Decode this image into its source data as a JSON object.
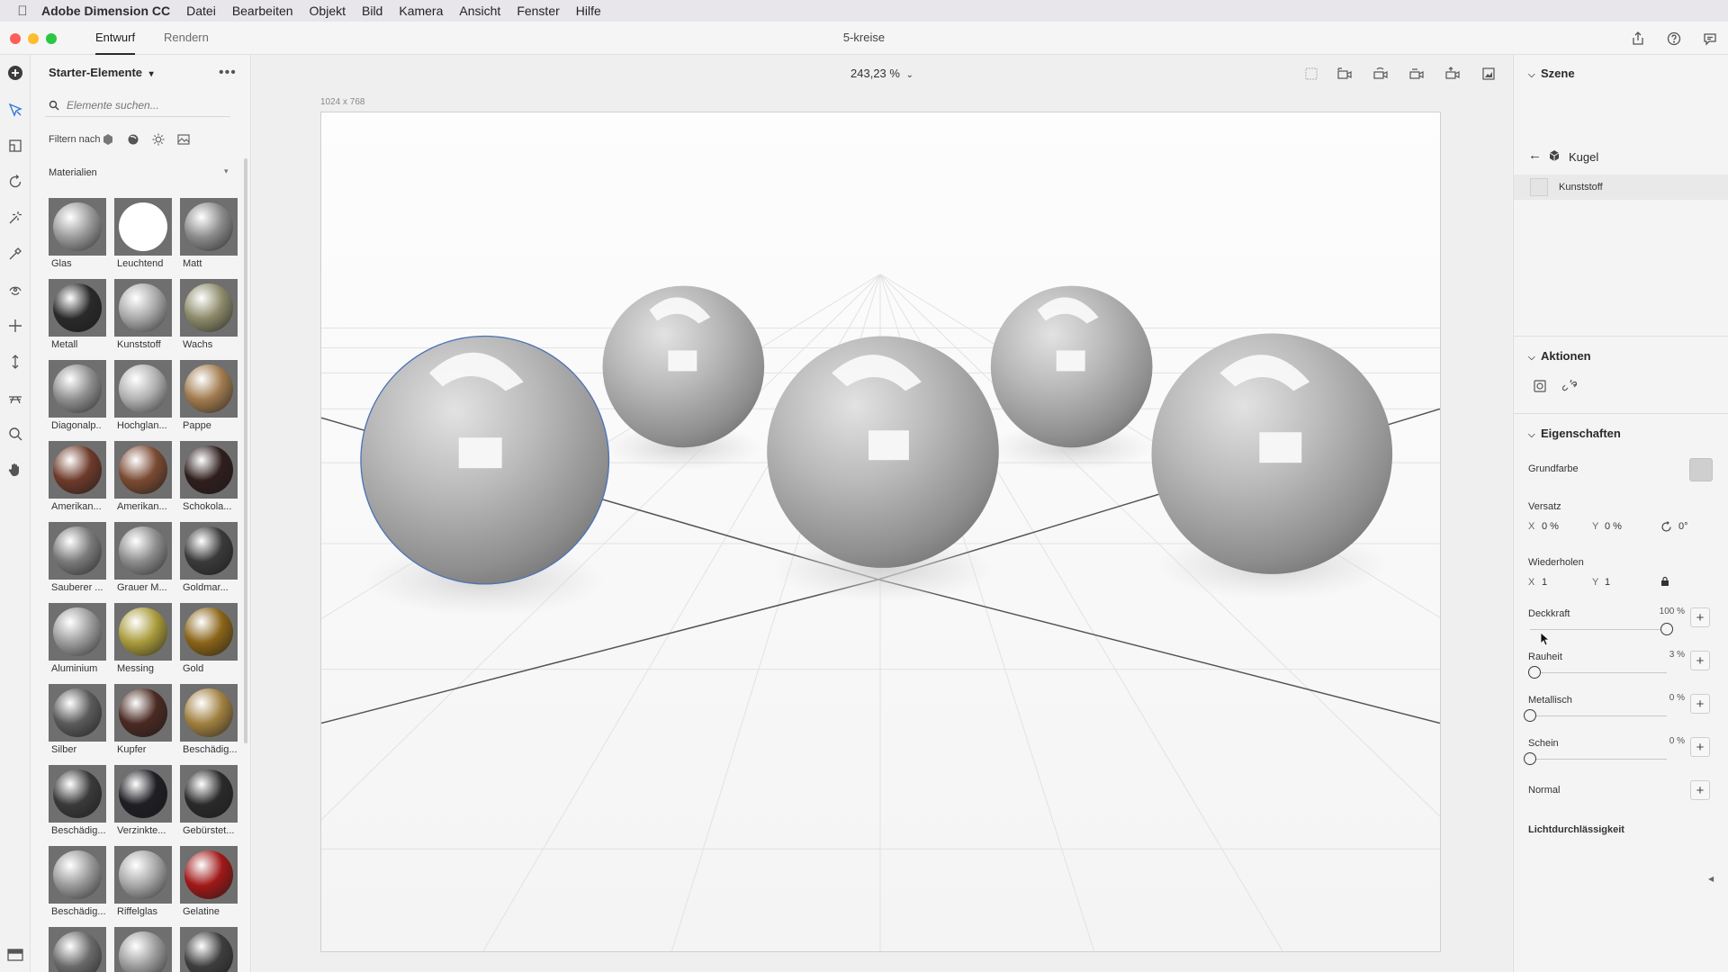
{
  "menubar": {
    "app_name": "Adobe Dimension CC",
    "items": [
      "Datei",
      "Bearbeiten",
      "Objekt",
      "Bild",
      "Kamera",
      "Ansicht",
      "Fenster",
      "Hilfe"
    ]
  },
  "titlebar": {
    "tabs": [
      "Entwurf",
      "Rendern"
    ],
    "active_tab": "Entwurf",
    "document_title": "5-kreise"
  },
  "assets": {
    "title": "Starter-Elemente",
    "search_placeholder": "Elemente suchen...",
    "filter_label": "Filtern nach",
    "section": "Materialien",
    "materials": [
      {
        "label": "Glas",
        "color": "#9a9a9a"
      },
      {
        "label": "Leuchtend",
        "color": "#ffffff"
      },
      {
        "label": "Matt",
        "color": "#8a8a8a"
      },
      {
        "label": "Metall",
        "color": "#2a2a2a"
      },
      {
        "label": "Kunststoff",
        "color": "#a8a8a8"
      },
      {
        "label": "Wachs",
        "color": "#8c8a6a"
      },
      {
        "label": "Diagonalp..",
        "color": "#8e8e8e"
      },
      {
        "label": "Hochglan...",
        "color": "#b0b0b0"
      },
      {
        "label": "Pappe",
        "color": "#a07a4e"
      },
      {
        "label": "Amerikan...",
        "color": "#6e3a2a"
      },
      {
        "label": "Amerikan...",
        "color": "#7a4a32"
      },
      {
        "label": "Schokola...",
        "color": "#2e1e1c"
      },
      {
        "label": "Sauberer ...",
        "color": "#7a7a7a"
      },
      {
        "label": "Grauer M...",
        "color": "#8c8c8c"
      },
      {
        "label": "Goldmar...",
        "color": "#3a3a3a"
      },
      {
        "label": "Aluminium",
        "color": "#9c9c9c"
      },
      {
        "label": "Messing",
        "color": "#a89a3a"
      },
      {
        "label": "Gold",
        "color": "#8a6418"
      },
      {
        "label": "Silber",
        "color": "#5a5a5a"
      },
      {
        "label": "Kupfer",
        "color": "#4a2a22"
      },
      {
        "label": "Beschädig...",
        "color": "#a08040"
      },
      {
        "label": "Beschädig...",
        "color": "#3a3a3a"
      },
      {
        "label": "Verzinkte...",
        "color": "#1e1e24"
      },
      {
        "label": "Gebürstet...",
        "color": "#2a2a2a"
      },
      {
        "label": "Beschädig...",
        "color": "#9a9a9a"
      },
      {
        "label": "Riffelglas",
        "color": "#a6a6a6"
      },
      {
        "label": "Gelatine",
        "color": "#a01818"
      },
      {
        "label": "",
        "color": "#6a6a6a"
      },
      {
        "label": "",
        "color": "#9a9a9a"
      },
      {
        "label": "",
        "color": "#3e3e3e"
      }
    ]
  },
  "canvas": {
    "zoom": "243,23 %",
    "size_label": "1024 x 768"
  },
  "right_panel": {
    "scene_title": "Szene",
    "object_name": "Kugel",
    "material_name": "Kunststoff",
    "actions_title": "Aktionen",
    "properties_title": "Eigenschaften",
    "grundfarbe_label": "Grundfarbe",
    "grundfarbe_color": "#cfcfcf",
    "versatz_label": "Versatz",
    "versatz_x_label": "X",
    "versatz_x": "0 %",
    "versatz_y_label": "Y",
    "versatz_y": "0 %",
    "versatz_rot": "0°",
    "wiederholen_label": "Wiederholen",
    "wiederholen_x_label": "X",
    "wiederholen_x": "1",
    "wiederholen_y_label": "Y",
    "wiederholen_y": "1",
    "sliders": [
      {
        "label": "Deckkraft",
        "value": "100 %",
        "fraction": 1.0
      },
      {
        "label": "Rauheit",
        "value": "3 %",
        "fraction": 0.03
      },
      {
        "label": "Metallisch",
        "value": "0 %",
        "fraction": 0.0
      },
      {
        "label": "Schein",
        "value": "0 %",
        "fraction": 0.0
      }
    ],
    "normal_label": "Normal",
    "lichtdurchlaessigkeit_label": "Lichtdurchlässigkeit"
  }
}
